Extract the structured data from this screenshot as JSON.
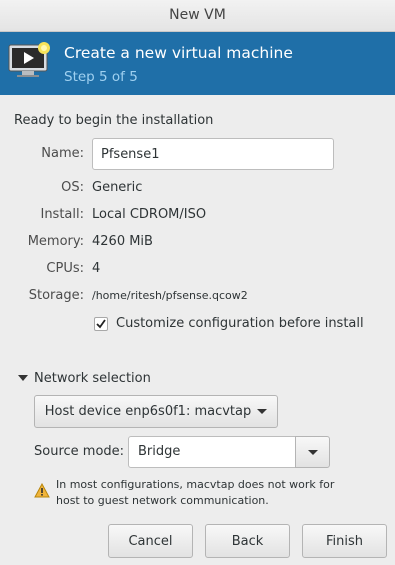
{
  "window": {
    "title": "New VM"
  },
  "header": {
    "icon": "virtual-machine-icon",
    "title": "Create a new virtual machine",
    "step": "Step 5 of 5",
    "color": "#1f6fa8"
  },
  "summary": {
    "heading": "Ready to begin the installation",
    "name_label": "Name:",
    "name_value": "Pfsense1",
    "os_label": "OS:",
    "os_value": "Generic",
    "install_label": "Install:",
    "install_value": "Local CDROM/ISO",
    "memory_label": "Memory:",
    "memory_value": "4260 MiB",
    "cpus_label": "CPUs:",
    "cpus_value": "4",
    "storage_label": "Storage:",
    "storage_value": "/home/ritesh/pfsense.qcow2",
    "customize_label": "Customize configuration before install",
    "customize_checked": true
  },
  "network": {
    "expander_label": "Network selection",
    "device_value": "Host device enp6s0f1: macvtap",
    "source_mode_label": "Source mode:",
    "source_mode_value": "Bridge",
    "warning_line1": "In most configurations, macvtap does not work for",
    "warning_line2": "host to guest network communication.",
    "warning_icon": "warning-icon"
  },
  "buttons": {
    "cancel": "Cancel",
    "back": "Back",
    "finish": "Finish"
  }
}
